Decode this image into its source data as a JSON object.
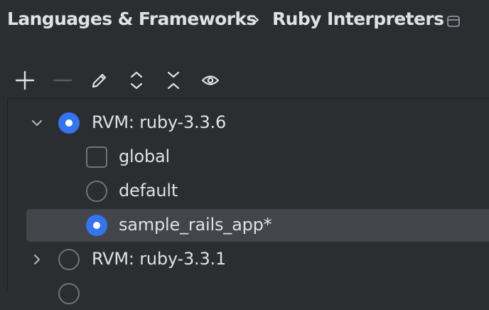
{
  "breadcrumb": {
    "parent": "Languages & Frameworks",
    "separator_icon": "chevron-right-icon",
    "current": "Ruby Interpreters"
  },
  "toolbar": {
    "buttons": [
      {
        "name": "add",
        "icon": "plus-icon"
      },
      {
        "name": "remove",
        "icon": "minus-icon",
        "enabled": false
      },
      {
        "name": "edit",
        "icon": "pencil-icon"
      },
      {
        "name": "expand-all",
        "icon": "expand-all-icon"
      },
      {
        "name": "collapse-all",
        "icon": "collapse-all-icon"
      },
      {
        "name": "show",
        "icon": "eye-icon"
      }
    ]
  },
  "tree": {
    "items": [
      {
        "label": "RVM: ruby-3.3.6",
        "expanded": true,
        "control": "radio",
        "checked": true
      },
      {
        "label": "global",
        "control": "checkbox",
        "checked": false
      },
      {
        "label": "default",
        "control": "radio",
        "checked": false
      },
      {
        "label": "sample_rails_app*",
        "control": "radio",
        "checked": true,
        "selected": true
      },
      {
        "label": "RVM: ruby-3.3.1",
        "expanded": false,
        "control": "radio",
        "checked": false
      }
    ]
  },
  "colors": {
    "background": "#2b2d30",
    "text": "#dfe1e5",
    "accent": "#3574f0",
    "selection": "#43454a",
    "control_border": "#6f737a"
  }
}
